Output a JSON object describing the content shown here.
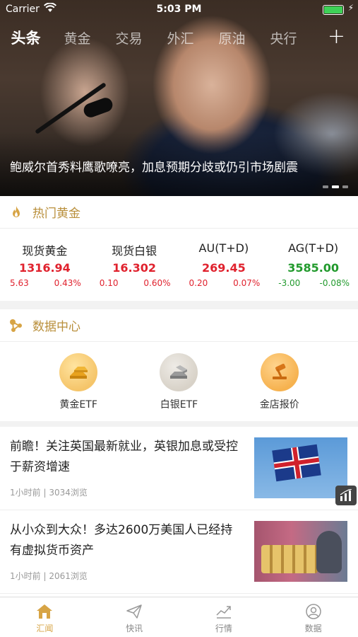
{
  "status": {
    "carrier": "Carrier",
    "time": "5:03 PM"
  },
  "tabs": [
    {
      "label": "头条",
      "active": true
    },
    {
      "label": "黄金"
    },
    {
      "label": "交易"
    },
    {
      "label": "外汇"
    },
    {
      "label": "原油"
    },
    {
      "label": "央行"
    }
  ],
  "tab_add_label": "+",
  "hero": {
    "headline": "鲍威尔首秀料鹰歌嘹亮，加息预期分歧或仍引市场剧震"
  },
  "hot_gold": {
    "title": "热门黄金",
    "quotes": [
      {
        "name": "现货黄金",
        "price": "1316.94",
        "change": "5.63",
        "pct": "0.43%",
        "trend": "up"
      },
      {
        "name": "现货白银",
        "price": "16.302",
        "change": "0.10",
        "pct": "0.60%",
        "trend": "up"
      },
      {
        "name": "AU(T+D)",
        "price": "269.45",
        "change": "0.20",
        "pct": "0.07%",
        "trend": "up"
      },
      {
        "name": "AG(T+D)",
        "price": "3585.00",
        "change": "-3.00",
        "pct": "-0.08%",
        "trend": "down"
      }
    ]
  },
  "data_center": {
    "title": "数据中心",
    "items": [
      {
        "label": "黄金ETF",
        "icon": "gold-bars-icon"
      },
      {
        "label": "白银ETF",
        "icon": "silver-bars-icon"
      },
      {
        "label": "金店报价",
        "icon": "gavel-icon"
      }
    ]
  },
  "news": [
    {
      "title": "前瞻！关注英国最新就业，英银加息或受控于薪资增速",
      "time": "1小时前",
      "views": "3034浏览"
    },
    {
      "title": "从小众到大众！多达2600万美国人已经持有虚拟货币资产",
      "time": "1小时前",
      "views": "2061浏览"
    }
  ],
  "tabbar": [
    {
      "label": "汇闻",
      "icon": "home-icon",
      "active": true
    },
    {
      "label": "快讯",
      "icon": "paper-plane-icon"
    },
    {
      "label": "行情",
      "icon": "trend-chart-icon"
    },
    {
      "label": "数据",
      "icon": "user-circle-icon"
    }
  ],
  "colors": {
    "accent": "#d7a445",
    "up": "#e0222e",
    "down": "#229a2d",
    "section_title": "#b98f3b"
  }
}
